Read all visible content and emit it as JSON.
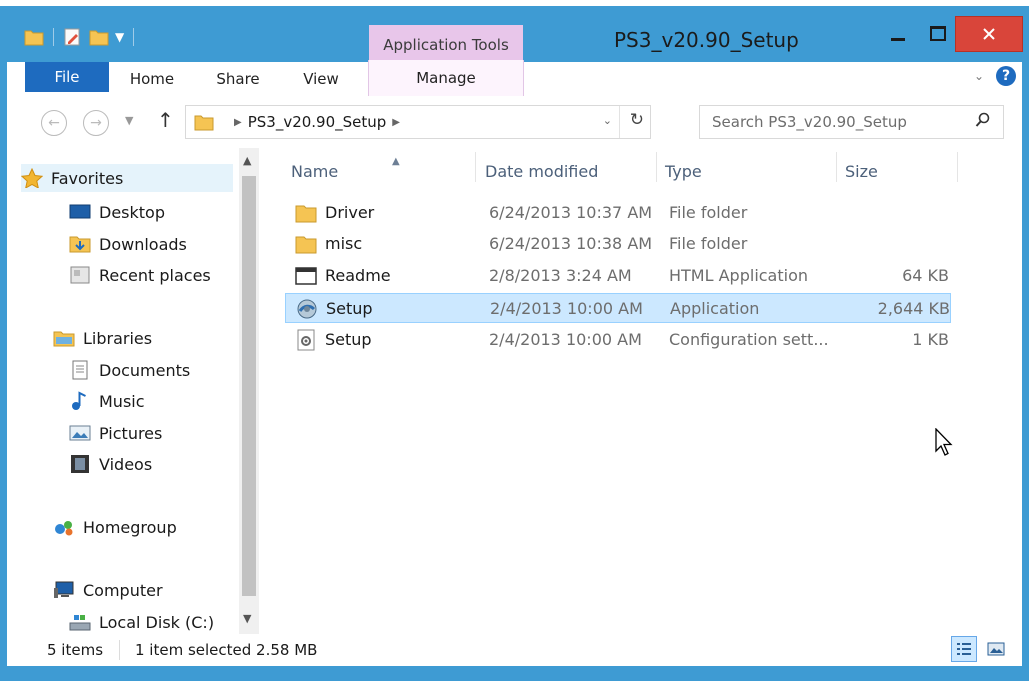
{
  "window": {
    "title": "PS3_v20.90_Setup",
    "context_tab_header": "Application Tools",
    "colors": {
      "frame": "#3e9bd3",
      "file_tab": "#1e6bbf",
      "close": "#d9453a",
      "context": "#e8c6ea",
      "selection": "#cce8ff"
    }
  },
  "quick_access": {
    "icons": [
      "folder-icon",
      "properties-icon",
      "new-folder-icon",
      "chevron-down-icon"
    ]
  },
  "ribbon": {
    "tabs": {
      "file": "File",
      "home": "Home",
      "share": "Share",
      "view": "View",
      "manage": "Manage"
    }
  },
  "address": {
    "path_segment": "PS3_v20.90_Setup",
    "search_placeholder": "Search PS3_v20.90_Setup"
  },
  "nav": {
    "favorites": "Favorites",
    "desktop": "Desktop",
    "downloads": "Downloads",
    "recent": "Recent places",
    "libraries": "Libraries",
    "documents": "Documents",
    "music": "Music",
    "pictures": "Pictures",
    "videos": "Videos",
    "homegroup": "Homegroup",
    "computer": "Computer",
    "local_disk": "Local Disk (C:)"
  },
  "columns": {
    "name": "Name",
    "date": "Date modified",
    "type": "Type",
    "size": "Size"
  },
  "files": [
    {
      "name": "Driver",
      "date": "6/24/2013 10:37 AM",
      "type": "File folder",
      "size": "",
      "icon": "folder-icon"
    },
    {
      "name": "misc",
      "date": "6/24/2013 10:38 AM",
      "type": "File folder",
      "size": "",
      "icon": "folder-icon"
    },
    {
      "name": "Readme",
      "date": "2/8/2013 3:24 AM",
      "type": "HTML Application",
      "size": "64 KB",
      "icon": "html-app-icon"
    },
    {
      "name": "Setup",
      "date": "2/4/2013 10:00 AM",
      "type": "Application",
      "size": "2,644 KB",
      "icon": "setup-app-icon",
      "selected": true
    },
    {
      "name": "Setup",
      "date": "2/4/2013 10:00 AM",
      "type": "Configuration sett...",
      "size": "1 KB",
      "icon": "config-settings-icon"
    }
  ],
  "status": {
    "count": "5 items",
    "selection": "1 item selected  2.58 MB"
  }
}
